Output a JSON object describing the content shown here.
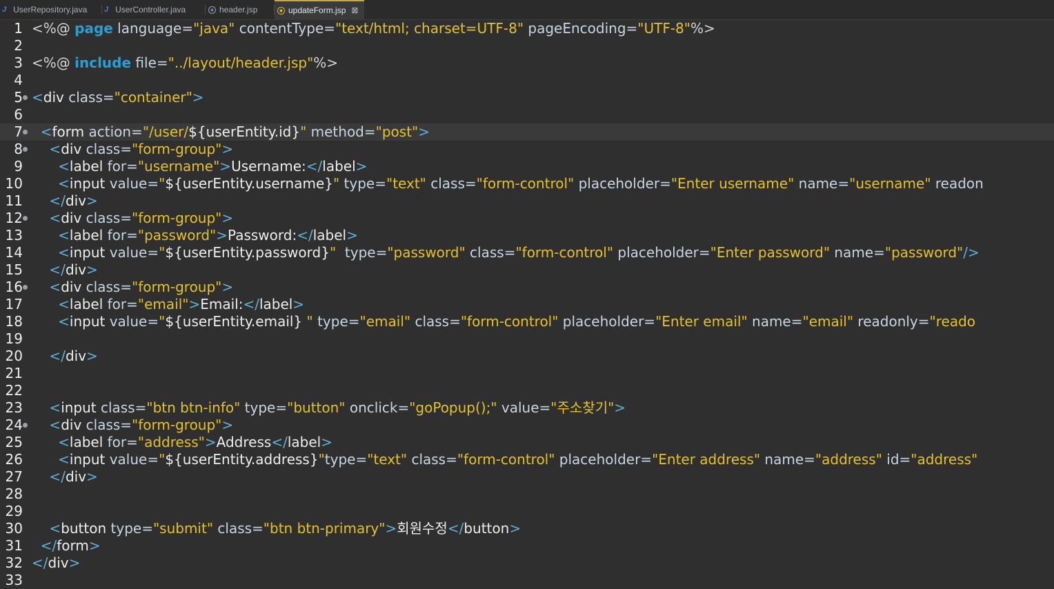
{
  "tabs": [
    {
      "label": "UserRepository.java",
      "icon": "java-file-icon"
    },
    {
      "label": "UserController.java",
      "icon": "java-file-icon"
    },
    {
      "label": "header.jsp",
      "icon": "jsp-file-icon"
    },
    {
      "label": "updateForm.jsp",
      "icon": "jsp-file-icon",
      "active": true,
      "close": "⊠"
    }
  ],
  "colors": {
    "tag": "#5fb1d9",
    "attr": "#c9d6e3",
    "value": "#e6c229",
    "text": "#eeeeee",
    "keyword": "#27a0d8",
    "directive": "#d6d6d6"
  },
  "lines": [
    {
      "n": "1",
      "tokens": [
        [
          "<%@ ",
          "directive"
        ],
        [
          "page",
          "keyword"
        ],
        [
          " language=",
          "attr"
        ],
        [
          "\"java\"",
          "value"
        ],
        [
          " contentType=",
          "attr"
        ],
        [
          "\"text/html; charset=UTF-8\"",
          "value"
        ],
        [
          " pageEncoding=",
          "attr"
        ],
        [
          "\"UTF-8\"",
          "value"
        ],
        [
          "%>",
          "directive"
        ]
      ]
    },
    {
      "n": "2",
      "tokens": []
    },
    {
      "n": "3",
      "tokens": [
        [
          "<%@ ",
          "directive"
        ],
        [
          "include",
          "keyword"
        ],
        [
          " file=",
          "attr"
        ],
        [
          "\"../layout/header.jsp\"",
          "value"
        ],
        [
          "%>",
          "directive"
        ]
      ]
    },
    {
      "n": "4",
      "tokens": []
    },
    {
      "n": "5",
      "fold": true,
      "tokens": [
        [
          "<",
          "tag"
        ],
        [
          "div",
          "text"
        ],
        [
          " class=",
          "attr"
        ],
        [
          "\"container\"",
          "value"
        ],
        [
          ">",
          "tag"
        ]
      ]
    },
    {
      "n": "6",
      "tokens": []
    },
    {
      "n": "7",
      "fold": true,
      "hl": true,
      "tokens": [
        [
          "  <",
          "tag"
        ],
        [
          "form",
          "text"
        ],
        [
          " action=",
          "attr"
        ],
        [
          "\"/user/",
          "value"
        ],
        [
          "${userEntity.id}",
          "text"
        ],
        [
          "\"",
          "value"
        ],
        [
          " method=",
          "attr"
        ],
        [
          "\"post\"",
          "value"
        ],
        [
          ">",
          "tag"
        ]
      ]
    },
    {
      "n": "8",
      "fold": true,
      "tokens": [
        [
          "    <",
          "tag"
        ],
        [
          "div",
          "text"
        ],
        [
          " class=",
          "attr"
        ],
        [
          "\"form-group\"",
          "value"
        ],
        [
          ">",
          "tag"
        ]
      ]
    },
    {
      "n": "9",
      "tokens": [
        [
          "      <",
          "tag"
        ],
        [
          "label",
          "text"
        ],
        [
          " for=",
          "attr"
        ],
        [
          "\"username\"",
          "value"
        ],
        [
          ">",
          "tag"
        ],
        [
          "Username:",
          "text"
        ],
        [
          "</",
          "tag"
        ],
        [
          "label",
          "text"
        ],
        [
          ">",
          "tag"
        ]
      ]
    },
    {
      "n": "10",
      "tokens": [
        [
          "      <",
          "tag"
        ],
        [
          "input",
          "text"
        ],
        [
          " value=",
          "attr"
        ],
        [
          "\"",
          "value"
        ],
        [
          "${userEntity.username}",
          "text"
        ],
        [
          "\"",
          "value"
        ],
        [
          " type=",
          "attr"
        ],
        [
          "\"text\"",
          "value"
        ],
        [
          " class=",
          "attr"
        ],
        [
          "\"form-control\"",
          "value"
        ],
        [
          " placeholder=",
          "attr"
        ],
        [
          "\"Enter username\"",
          "value"
        ],
        [
          " name=",
          "attr"
        ],
        [
          "\"username\"",
          "value"
        ],
        [
          " readon",
          "attr"
        ]
      ]
    },
    {
      "n": "11",
      "tokens": [
        [
          "    </",
          "tag"
        ],
        [
          "div",
          "text"
        ],
        [
          ">",
          "tag"
        ]
      ]
    },
    {
      "n": "12",
      "fold": true,
      "tokens": [
        [
          "    <",
          "tag"
        ],
        [
          "div",
          "text"
        ],
        [
          " class=",
          "attr"
        ],
        [
          "\"form-group\"",
          "value"
        ],
        [
          ">",
          "tag"
        ]
      ]
    },
    {
      "n": "13",
      "tokens": [
        [
          "      <",
          "tag"
        ],
        [
          "label",
          "text"
        ],
        [
          " for=",
          "attr"
        ],
        [
          "\"password\"",
          "value"
        ],
        [
          ">",
          "tag"
        ],
        [
          "Password:",
          "text"
        ],
        [
          "</",
          "tag"
        ],
        [
          "label",
          "text"
        ],
        [
          ">",
          "tag"
        ]
      ]
    },
    {
      "n": "14",
      "tokens": [
        [
          "      <",
          "tag"
        ],
        [
          "input",
          "text"
        ],
        [
          " value=",
          "attr"
        ],
        [
          "\"",
          "value"
        ],
        [
          "${userEntity.password}",
          "text"
        ],
        [
          "\"  ",
          "value"
        ],
        [
          "type=",
          "attr"
        ],
        [
          "\"password\"",
          "value"
        ],
        [
          " class=",
          "attr"
        ],
        [
          "\"form-control\"",
          "value"
        ],
        [
          " placeholder=",
          "attr"
        ],
        [
          "\"Enter password\"",
          "value"
        ],
        [
          " name=",
          "attr"
        ],
        [
          "\"password\"",
          "value"
        ],
        [
          "/>",
          "tag"
        ]
      ]
    },
    {
      "n": "15",
      "tokens": [
        [
          "    </",
          "tag"
        ],
        [
          "div",
          "text"
        ],
        [
          ">",
          "tag"
        ]
      ]
    },
    {
      "n": "16",
      "fold": true,
      "tokens": [
        [
          "    <",
          "tag"
        ],
        [
          "div",
          "text"
        ],
        [
          " class=",
          "attr"
        ],
        [
          "\"form-group\"",
          "value"
        ],
        [
          ">",
          "tag"
        ]
      ]
    },
    {
      "n": "17",
      "tokens": [
        [
          "      <",
          "tag"
        ],
        [
          "label",
          "text"
        ],
        [
          " for=",
          "attr"
        ],
        [
          "\"email\"",
          "value"
        ],
        [
          ">",
          "tag"
        ],
        [
          "Email:",
          "text"
        ],
        [
          "</",
          "tag"
        ],
        [
          "label",
          "text"
        ],
        [
          ">",
          "tag"
        ]
      ]
    },
    {
      "n": "18",
      "tokens": [
        [
          "      <",
          "tag"
        ],
        [
          "input",
          "text"
        ],
        [
          " value=",
          "attr"
        ],
        [
          "\"",
          "value"
        ],
        [
          "${userEntity.email} ",
          "text"
        ],
        [
          "\"",
          "value"
        ],
        [
          " type=",
          "attr"
        ],
        [
          "\"email\"",
          "value"
        ],
        [
          " class=",
          "attr"
        ],
        [
          "\"form-control\"",
          "value"
        ],
        [
          " placeholder=",
          "attr"
        ],
        [
          "\"Enter email\"",
          "value"
        ],
        [
          " name=",
          "attr"
        ],
        [
          "\"email\"",
          "value"
        ],
        [
          " readonly=",
          "attr"
        ],
        [
          "\"reado",
          "value"
        ]
      ]
    },
    {
      "n": "19",
      "tokens": []
    },
    {
      "n": "20",
      "tokens": [
        [
          "    </",
          "tag"
        ],
        [
          "div",
          "text"
        ],
        [
          ">",
          "tag"
        ]
      ]
    },
    {
      "n": "21",
      "tokens": []
    },
    {
      "n": "22",
      "tokens": []
    },
    {
      "n": "23",
      "tokens": [
        [
          "    <",
          "tag"
        ],
        [
          "input",
          "text"
        ],
        [
          " class=",
          "attr"
        ],
        [
          "\"btn btn-info\"",
          "value"
        ],
        [
          " type=",
          "attr"
        ],
        [
          "\"button\"",
          "value"
        ],
        [
          " onclick=",
          "attr"
        ],
        [
          "\"goPopup();\"",
          "value"
        ],
        [
          " value=",
          "attr"
        ],
        [
          "\"주소찾기\"",
          "value"
        ],
        [
          ">",
          "tag"
        ]
      ]
    },
    {
      "n": "24",
      "fold": true,
      "tokens": [
        [
          "    <",
          "tag"
        ],
        [
          "div",
          "text"
        ],
        [
          " class=",
          "attr"
        ],
        [
          "\"form-group\"",
          "value"
        ],
        [
          ">",
          "tag"
        ]
      ]
    },
    {
      "n": "25",
      "tokens": [
        [
          "      <",
          "tag"
        ],
        [
          "label",
          "text"
        ],
        [
          " for=",
          "attr"
        ],
        [
          "\"address\"",
          "value"
        ],
        [
          ">",
          "tag"
        ],
        [
          "Address",
          "text"
        ],
        [
          "</",
          "tag"
        ],
        [
          "label",
          "text"
        ],
        [
          ">",
          "tag"
        ]
      ]
    },
    {
      "n": "26",
      "tokens": [
        [
          "      <",
          "tag"
        ],
        [
          "input",
          "text"
        ],
        [
          " value=",
          "attr"
        ],
        [
          "\"",
          "value"
        ],
        [
          "${userEntity.address}",
          "text"
        ],
        [
          "\"",
          "value"
        ],
        [
          "type=",
          "attr"
        ],
        [
          "\"text\"",
          "value"
        ],
        [
          " class=",
          "attr"
        ],
        [
          "\"form-control\"",
          "value"
        ],
        [
          " placeholder=",
          "attr"
        ],
        [
          "\"Enter address\"",
          "value"
        ],
        [
          " name=",
          "attr"
        ],
        [
          "\"address\"",
          "value"
        ],
        [
          " id=",
          "attr"
        ],
        [
          "\"address\"",
          "value"
        ]
      ]
    },
    {
      "n": "27",
      "tokens": [
        [
          "    </",
          "tag"
        ],
        [
          "div",
          "text"
        ],
        [
          ">",
          "tag"
        ]
      ]
    },
    {
      "n": "28",
      "tokens": []
    },
    {
      "n": "29",
      "tokens": []
    },
    {
      "n": "30",
      "tokens": [
        [
          "    <",
          "tag"
        ],
        [
          "button",
          "text"
        ],
        [
          " type=",
          "attr"
        ],
        [
          "\"submit\"",
          "value"
        ],
        [
          " class=",
          "attr"
        ],
        [
          "\"btn btn-primary\"",
          "value"
        ],
        [
          ">",
          "tag"
        ],
        [
          "회원수정",
          "text"
        ],
        [
          "</",
          "tag"
        ],
        [
          "button",
          "text"
        ],
        [
          ">",
          "tag"
        ]
      ]
    },
    {
      "n": "31",
      "tokens": [
        [
          "  </",
          "tag"
        ],
        [
          "form",
          "text"
        ],
        [
          ">",
          "tag"
        ]
      ]
    },
    {
      "n": "32",
      "tokens": [
        [
          "</",
          "tag"
        ],
        [
          "div",
          "text"
        ],
        [
          ">",
          "tag"
        ]
      ]
    },
    {
      "n": "33",
      "tokens": []
    }
  ]
}
